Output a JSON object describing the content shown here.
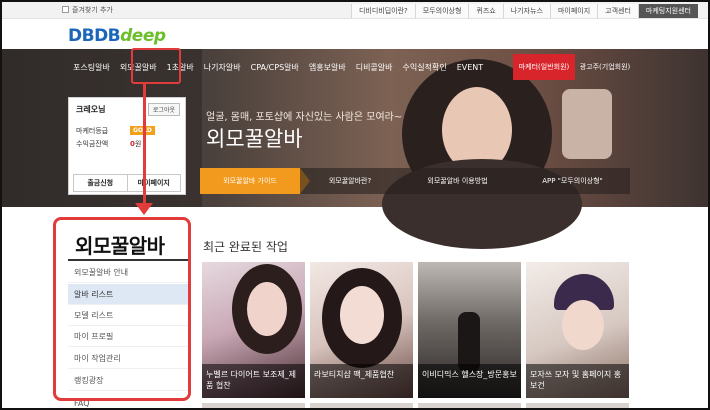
{
  "top_bar": {
    "bookmark": "즐겨찾기 추가",
    "links": [
      "디비디비딥이란?",
      "모두의이상형",
      "퀴즈쇼",
      "나기자뉴스",
      "마이페이지",
      "고객센터",
      "마케팅지원센터"
    ]
  },
  "logo": {
    "part1": "DBDB",
    "part2": "deep"
  },
  "nav": {
    "items": [
      "포스팅알바",
      "외모꿀알바",
      "1초알바",
      "나기자알바",
      "CPA/CPS알바",
      "앱홍보알바",
      "디비콜알바",
      "수익실적확인",
      "EVENT"
    ],
    "btn_marketer": "마케터(일반회원)",
    "btn_advertiser": "광고주(기업회원)"
  },
  "login": {
    "user": "크레오님",
    "logout": "로그아웃",
    "grade_label": "마케터등급",
    "grade_value": "GOLD",
    "profit_label": "수익금잔액",
    "profit_value": "0",
    "profit_unit": "원",
    "btn_withdraw": "출금신청",
    "btn_mypage": "마이페이지"
  },
  "hero": {
    "subtitle": "얼굴, 몸매, 포토샵에 자신있는 사람은 모여라~",
    "title": "외모꿀알바",
    "tabs": [
      "외모꿀알바 가이드",
      "외모꿀알바란?",
      "외모꿀알바 이용방법",
      "APP \"모두의이상형\""
    ]
  },
  "sidebar": {
    "title": "외모꿀알바",
    "items": [
      "외모꿀알바 안내",
      "알바 리스트",
      "모델 리스트",
      "마이 프로필",
      "마이 작업관리",
      "랭킹광장",
      "FAQ"
    ]
  },
  "content": {
    "title": "최근 완료된 작업",
    "cards": [
      {
        "caption": "누벨르 다이어트 보조제_제품 협찬"
      },
      {
        "caption": "라보티치샵 팩_제품협찬"
      },
      {
        "caption": "이비디믹스 헬스장_방문홍보"
      },
      {
        "caption": "모자쓰 모자 및 홈페이지 홍보건"
      }
    ]
  },
  "colors": {
    "brand_blue": "#1b66b9",
    "brand_green": "#6cbf2b",
    "accent_red": "#d8252c",
    "tab_orange": "#f29a1d",
    "highlight": "#e23b3b"
  }
}
